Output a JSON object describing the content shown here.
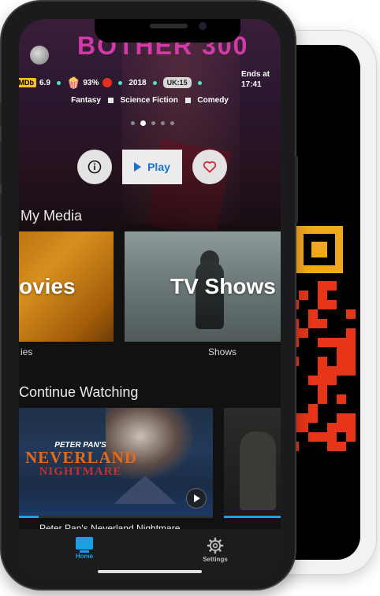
{
  "hero": {
    "title_art": "BOTHER 300",
    "imdb_label": "IMDb",
    "imdb_score": "6.9",
    "audience_score": "93%",
    "year": "2018",
    "rating": "UK:15",
    "ends_label": "Ends at",
    "ends_time": "17:41",
    "genres": [
      "Fantasy",
      "Science Fiction",
      "Comedy"
    ],
    "pager_active": 1,
    "pager_count": 5,
    "play_label": "Play"
  },
  "my_media": {
    "title": "My Media",
    "tiles": [
      {
        "label": "ovies",
        "caption": "ies"
      },
      {
        "label": "TV Shows",
        "caption": "Shows"
      }
    ]
  },
  "continue_watching": {
    "title": "Continue Watching",
    "items": [
      {
        "title": "Peter Pan's Neverland Nightmare",
        "logo_top": "PETER PAN'S",
        "logo_mid": "NEVERLAND",
        "logo_bottom": "NIGHTMARE",
        "progress": 0.1
      },
      {
        "title": "",
        "progress": 0.85
      }
    ]
  },
  "tabbar": {
    "home": "Home",
    "settings": "Settings"
  },
  "colors": {
    "accent": "#1a9fe0",
    "qr": "#e83418",
    "qr_finder": "#f2a81d"
  }
}
